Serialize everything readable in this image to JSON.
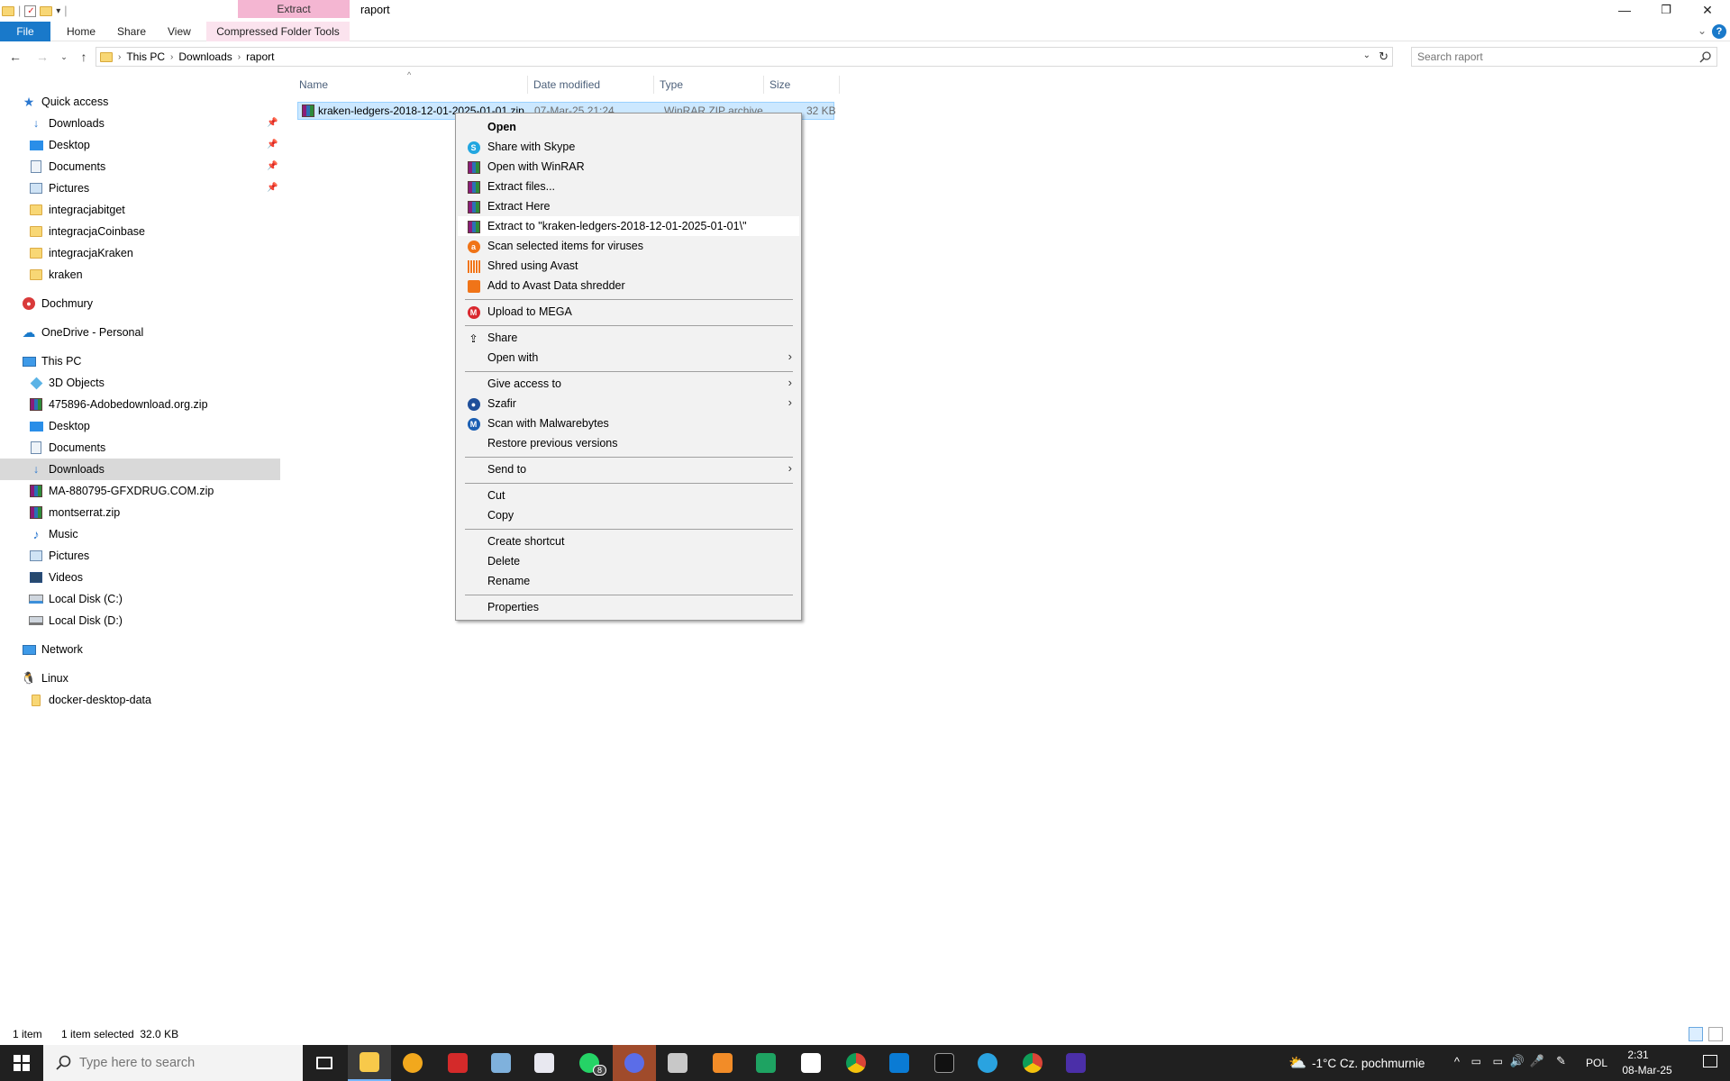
{
  "window": {
    "title": "raport",
    "context_tab_group": "Extract",
    "controls": {
      "minimize": "—",
      "restore": "❐",
      "close": "✕"
    }
  },
  "ribbon": {
    "tabs": [
      "File",
      "Home",
      "Share",
      "View",
      "Compressed Folder Tools"
    ]
  },
  "address": {
    "crumbs": [
      "This PC",
      "Downloads",
      "raport"
    ],
    "search_placeholder": "Search raport"
  },
  "nav": {
    "quick_access": "Quick access",
    "quick_items": [
      "Downloads",
      "Desktop",
      "Documents",
      "Pictures",
      "integracjabitget",
      "integracjaCoinbase",
      "integracjaKraken",
      "kraken"
    ],
    "dochmury": "Dochmury",
    "onedrive": "OneDrive - Personal",
    "this_pc": "This PC",
    "pc_items": [
      "3D Objects",
      "475896-Adobedownload.org.zip",
      "Desktop",
      "Documents",
      "Downloads",
      "MA-880795-GFXDRUG.COM.zip",
      "montserrat.zip",
      "Music",
      "Pictures",
      "Videos",
      "Local Disk (C:)",
      "Local Disk (D:)"
    ],
    "network": "Network",
    "linux": "Linux",
    "linux_items": [
      "docker-desktop-data"
    ]
  },
  "columns": [
    "Name",
    "Date modified",
    "Type",
    "Size"
  ],
  "file": {
    "name": "kraken-ledgers-2018-12-01-2025-01-01.zip",
    "date": "07-Mar-25 21:24",
    "type": "WinRAR ZIP archive",
    "size": "32 KB"
  },
  "menu": {
    "open": "Open",
    "skype": "Share with Skype",
    "open_winrar": "Open with WinRAR",
    "extract_files": "Extract files...",
    "extract_here": "Extract Here",
    "extract_to": "Extract to \"kraken-ledgers-2018-12-01-2025-01-01\\\"",
    "scan_avast": "Scan selected items for viruses",
    "shred_avast": "Shred using Avast",
    "avast_shredder": "Add to Avast Data shredder",
    "mega": "Upload to MEGA",
    "share": "Share",
    "open_with": "Open with",
    "give_access": "Give access to",
    "szafir": "Szafir",
    "malwarebytes": "Scan with Malwarebytes",
    "restore": "Restore previous versions",
    "send_to": "Send to",
    "cut": "Cut",
    "copy": "Copy",
    "create_shortcut": "Create shortcut",
    "delete": "Delete",
    "rename": "Rename",
    "properties": "Properties"
  },
  "status": {
    "count": "1 item",
    "selected": "1 item selected  32.0 KB"
  },
  "taskbar": {
    "search_placeholder": "Type here to search",
    "whatsapp_badge": "8",
    "weather": "-1°C  Cz. pochmurnie",
    "lang": "POL",
    "time": "2:31",
    "date": "08-Mar-25"
  }
}
